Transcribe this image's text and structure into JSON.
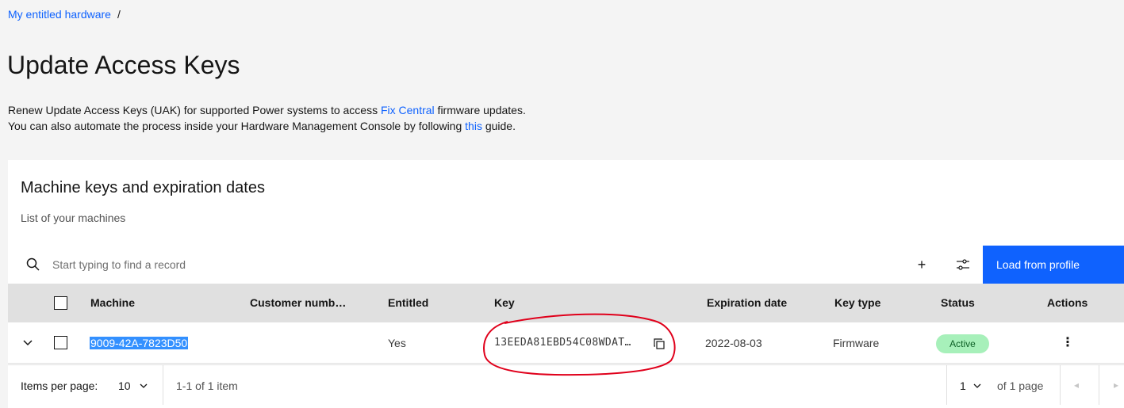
{
  "breadcrumb": {
    "link": "My entitled hardware",
    "separator": "/"
  },
  "page": {
    "title": "Update Access Keys"
  },
  "description": {
    "line1_before": "Renew Update Access Keys (UAK) for supported Power systems to access ",
    "line1_link": "Fix Central",
    "line1_after": " firmware updates.",
    "line2_before": "You can also automate the process inside your Hardware Management Console by following ",
    "line2_link": "this",
    "line2_after": " guide."
  },
  "card": {
    "title": "Machine keys and expiration dates",
    "subtitle": "List of your machines"
  },
  "toolbar": {
    "search_placeholder": "Start typing to find a record",
    "search_icon": "search-icon",
    "add_label": "+",
    "settings_icon": "settings-icon",
    "load_button": "Load from profile"
  },
  "table": {
    "headers": {
      "machine": "Machine",
      "customer": "Customer numb…",
      "entitled": "Entitled",
      "key": "Key",
      "expiration": "Expiration date",
      "key_type": "Key type",
      "status": "Status",
      "actions": "Actions"
    },
    "rows": [
      {
        "machine": "9009-42A-7823D50",
        "customer": "",
        "entitled": "Yes",
        "key": "13EEDA81EBD54C08WDAT…",
        "expiration": "2022-08-03",
        "key_type": "Firmware",
        "status": "Active",
        "actions": "⋮"
      }
    ]
  },
  "pagination": {
    "items_per_page_label": "Items per page:",
    "page_size": "10",
    "range": "1-1 of 1 item",
    "current_page": "1",
    "of_pages": "of 1 page",
    "prev": "◂",
    "next": "▸"
  },
  "colors": {
    "primary": "#0f62fe",
    "status_active_bg": "#a7f0ba",
    "annotation": "#e0001b"
  }
}
